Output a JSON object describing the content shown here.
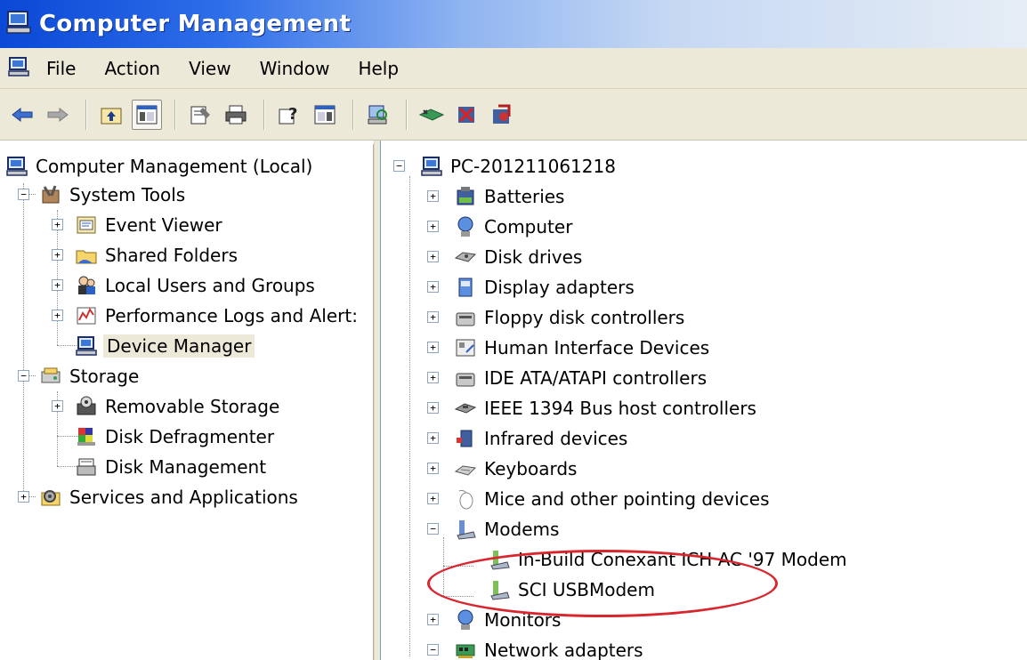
{
  "window": {
    "title": "Computer Management"
  },
  "menu": [
    "File",
    "Action",
    "View",
    "Window",
    "Help"
  ],
  "toolbar": {
    "buttons": [
      "back",
      "forward",
      "up",
      "show-hide-console-tree",
      "properties",
      "print",
      "help",
      "show-hide-action-pane",
      "scan-hardware",
      "uninstall",
      "disable",
      "update-driver"
    ]
  },
  "left_tree": {
    "root": "Computer Management (Local)",
    "system_tools": "System Tools",
    "event_viewer": "Event Viewer",
    "shared_folders": "Shared Folders",
    "local_users": "Local Users and Groups",
    "performance_logs": "Performance Logs and Alert:",
    "device_manager": "Device Manager",
    "storage": "Storage",
    "removable_storage": "Removable Storage",
    "disk_defrag": "Disk Defragmenter",
    "disk_management": "Disk Management",
    "services_apps": "Services and Applications"
  },
  "right_tree": {
    "root": "PC-201211061218",
    "batteries": "Batteries",
    "computer": "Computer",
    "disk_drives": "Disk drives",
    "display_adapters": "Display adapters",
    "floppy": "Floppy disk controllers",
    "hid": "Human Interface Devices",
    "ide": "IDE ATA/ATAPI controllers",
    "ieee1394": "IEEE 1394 Bus host controllers",
    "infrared": "Infrared devices",
    "keyboards": "Keyboards",
    "mice": "Mice and other pointing devices",
    "modems": "Modems",
    "modem1": "In-Build Conexant ICH AC '97 Modem",
    "modem2": "SCI USBModem",
    "monitors": "Monitors",
    "network": "Network adapters"
  },
  "colors": {
    "title_gradient_start": "#0a48d6",
    "chrome": "#ece9d8",
    "highlight_circle": "#d9262e"
  }
}
